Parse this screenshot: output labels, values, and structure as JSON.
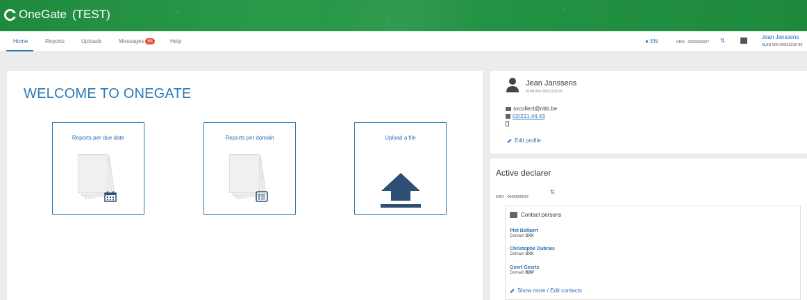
{
  "app": {
    "name": "OneGate",
    "environment": "(TEST)"
  },
  "nav": {
    "tabs": [
      {
        "label": "Home"
      },
      {
        "label": "Reports"
      },
      {
        "label": "Uploads"
      },
      {
        "label": "Messages",
        "badge": "65"
      },
      {
        "label": "Help"
      }
    ],
    "active_tab": "Home",
    "language": "EN",
    "kbo": "KBO - 0000000097",
    "user_name": "Jean Janssens",
    "user_nuin": "NUIN 800-00021232-90"
  },
  "main": {
    "welcome": "WELCOME TO ONEGATE",
    "tiles": [
      {
        "label": "Reports per due date",
        "icon": "calendar-icon"
      },
      {
        "label": "Reports per domain",
        "icon": "list-icon"
      },
      {
        "label": "Upload a file",
        "icon": "upload-icon"
      }
    ]
  },
  "profile": {
    "name": "Jean Janssens",
    "nuin": "NUIN 800-00021232-90",
    "email": "sxcollect@nbb.be",
    "phone": "02/221.44.43",
    "mobile": "",
    "edit_label": "Edit profile"
  },
  "declarer": {
    "title": "Active declarer",
    "kbo": "KBO - 0000000097",
    "contacts_title": "Contact persons",
    "contacts": [
      {
        "name": "Piet Bollaert",
        "domain_label": "Domain",
        "domain": "SXX"
      },
      {
        "name": "Christophe Dubrais",
        "domain_label": "Domain",
        "domain": "SXX"
      },
      {
        "name": "Geert Geerts",
        "domain_label": "Domain",
        "domain": "BBP"
      }
    ],
    "show_more_label": "Show more / Edit contacts"
  },
  "colors": {
    "header": "#249244",
    "accent": "#2a6fb3",
    "badge": "#e74c3c"
  }
}
